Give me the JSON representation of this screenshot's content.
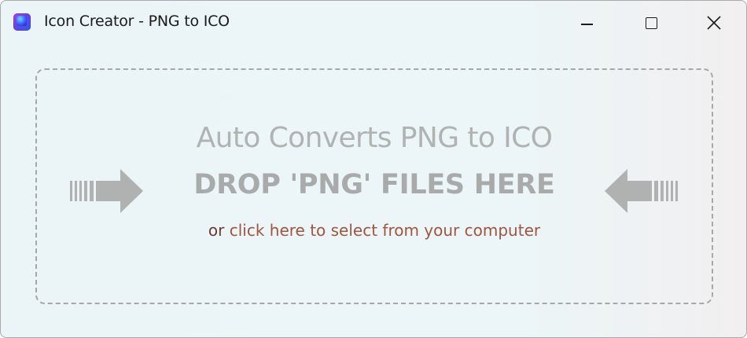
{
  "window": {
    "title": "Icon Creator - PNG to ICO",
    "icon": "app-icon"
  },
  "title_bar_buttons": {
    "minimize": "minimize-icon",
    "maximize": "maximize-icon",
    "close": "close-icon"
  },
  "drop_zone": {
    "heading": "Auto Converts PNG to ICO",
    "instruction": "DROP 'PNG' FILES HERE",
    "or_text": "or",
    "select_link": "click here to select from your computer",
    "left_arrow_icon": "arrow-right-icon",
    "right_arrow_icon": "arrow-left-icon"
  },
  "colors": {
    "background": "#ebf5f7",
    "dashed_border": "#a6a8a8",
    "muted_text": "#b1b3b3",
    "bold_text": "#a9abab",
    "link": "#a0563d",
    "or_text": "#6b3b2e",
    "arrow": "#b0b2b2"
  }
}
